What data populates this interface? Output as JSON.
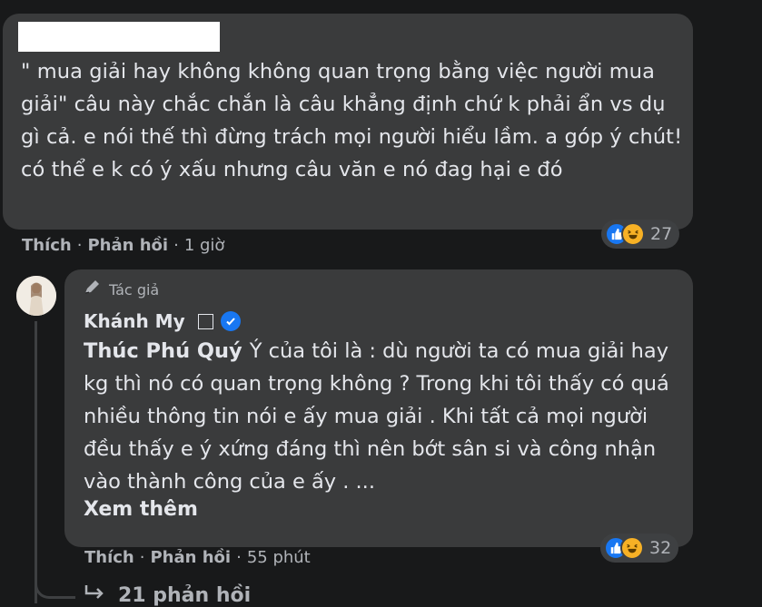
{
  "comment1": {
    "text": "\" mua giải hay không không quan trọng bằng việc người mua giải\" câu này chắc chắn là câu khẳng định chứ k phải ẩn vs dụ gì cả. e nói thế thì đừng trách mọi người hiểu lầm. a góp ý chút! có thể e k có ý xấu nhưng câu văn e nó đag hại e đó",
    "like_label": "Thích",
    "reply_label": "Phản hồi",
    "time": "1 giờ",
    "reaction_count": "27",
    "reaction_icons": [
      "like-icon",
      "haha-icon"
    ]
  },
  "reply": {
    "author_badge": "Tác giả",
    "author_name": "Khánh My",
    "mention": "Thúc Phú Quý",
    "text": "Ý của tôi là : dù người ta có mua giải hay kg thì nó có quan trọng không ? Trong khi tôi thấy có quá nhiều thông tin nói e ấy mua giải . Khi tất cả mọi người đều thấy e ý xứng đáng thì nên bớt sân si và công nhận vào thành công của e ấy . ...",
    "see_more": "Xem thêm",
    "like_label": "Thích",
    "reply_label": "Phản hồi",
    "time": "55 phút",
    "reaction_count": "32",
    "reaction_icons": [
      "like-icon",
      "haha-icon"
    ]
  },
  "replies_link": "21 phản hồi",
  "colors": {
    "background": "#18191a",
    "bubble": "#3a3b3c",
    "text": "#e4e6eb",
    "secondary_text": "#b0b3b8",
    "accent": "#1877f2",
    "haha": "#f7b125"
  }
}
